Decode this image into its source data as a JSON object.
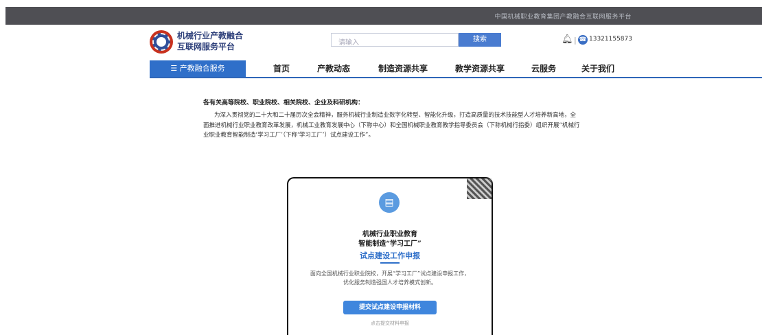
{
  "top_bar": {
    "text": "中国机械职业教育集团产教融合互联网服务平台"
  },
  "header": {
    "logo_line1": "机械行业产教融合",
    "logo_line2": "互联网服务平台",
    "search_placeholder": "请输入",
    "search_button": "搜索",
    "phone_icon": "phone-icon",
    "phone": "13321155873"
  },
  "nav": {
    "services": "☰ 产教融合服务",
    "items": [
      "首页",
      "产教动态",
      "制造资源共享",
      "教学资源共享",
      "云服务",
      "关于我们"
    ]
  },
  "intro": {
    "title": "各有关高等院校、职业院校、相关院校、企业及科研机构：",
    "body": "为深入贯彻党的二十大和二十届历次全会精神，服务机械行业制造业数字化转型、智能化升级，打造高质量的技术技能型人才培养新高地，全面推进机械行业职业教育改革发展，机械工业教育发展中心（下称中心）和全国机械职业教育教学指导委员会（下称机械行指委）组织开展“机械行业职业教育智能制造‘学习工厂’（下称‘学习工厂’）试点建设工作”。"
  },
  "card": {
    "line1": "机械行业职业教育",
    "line2": "智能制造“学习工厂”",
    "title": "试点建设工作申报",
    "desc": "面向全国机械行业职业院校，开展“学习工厂”试点建设申报工作，优化服务制造强国人才培养模式创新。",
    "button": "提交试点建设申报材料",
    "note": "点击提交材料申报"
  }
}
